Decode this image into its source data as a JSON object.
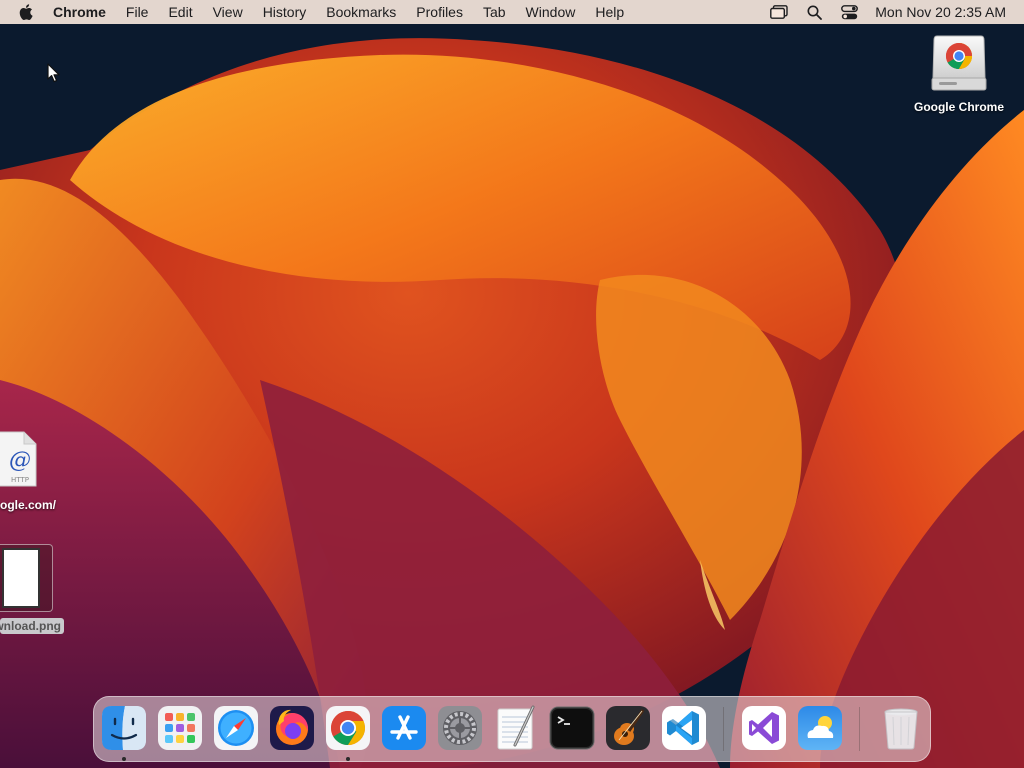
{
  "menubar": {
    "app_name": "Chrome",
    "menus": [
      "File",
      "Edit",
      "View",
      "History",
      "Bookmarks",
      "Profiles",
      "Tab",
      "Window",
      "Help"
    ],
    "status_icons": [
      "window-switcher-icon",
      "spotlight-search-icon",
      "control-center-icon"
    ],
    "clock": "Mon Nov 20  2:35 AM"
  },
  "desktop": {
    "icons": [
      {
        "label": "Google Chrome",
        "icon": "chrome-disk-image-icon"
      },
      {
        "label": "ogle.com/",
        "icon": "webloc-file-icon"
      },
      {
        "label": "wnload.png",
        "icon": "png-file-icon"
      }
    ]
  },
  "dock": {
    "apps": [
      "Finder",
      "Launchpad",
      "Safari",
      "Firefox",
      "Google Chrome",
      "App Store",
      "System Settings",
      "TextEdit",
      "Terminal",
      "GarageBand",
      "Visual Studio Code",
      "Visual Studio",
      "Weather",
      "Trash"
    ],
    "running": [
      "Finder",
      "Google Chrome"
    ]
  },
  "colors": {
    "menubar_bg": "#f6e6dc",
    "wallpaper_dark": "#0b1a2e",
    "wallpaper_orange": "#f07a1c",
    "wallpaper_red": "#c0311c",
    "wallpaper_magenta": "#7a1a3a"
  }
}
